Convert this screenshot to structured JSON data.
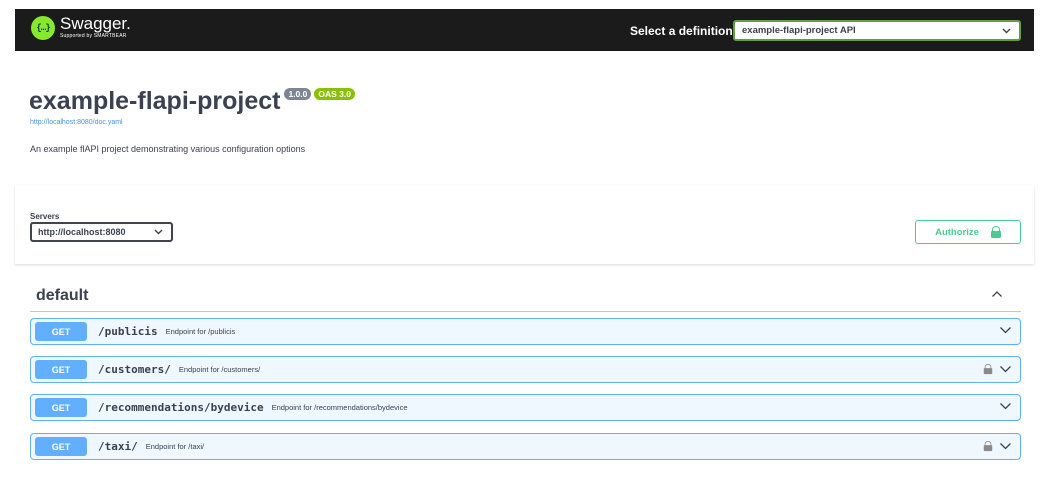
{
  "topbar": {
    "logo_mark": "{…}",
    "logo_name": "Swagger.",
    "logo_sub": "Supported by SMARTBEAR",
    "definition_label": "Select a definition",
    "definition_value": "example-flapi-project API"
  },
  "info": {
    "title": "example-flapi-project",
    "version": "1.0.0",
    "oas": "OAS 3.0",
    "doc_url": "http://localhost:8080/doc.yaml",
    "description": "An example flAPI project demonstrating various configuration options"
  },
  "servers": {
    "label": "Servers",
    "selected": "http://localhost:8080",
    "authorize_label": "Authorize"
  },
  "tag": {
    "name": "default",
    "expanded": true
  },
  "operations": [
    {
      "method": "GET",
      "path": "/publicis",
      "summary": "Endpoint for /publicis",
      "locked": false
    },
    {
      "method": "GET",
      "path": "/customers/",
      "summary": "Endpoint for /customers/",
      "locked": true
    },
    {
      "method": "GET",
      "path": "/recommendations/bydevice",
      "summary": "Endpoint for /recommendations/bydevice",
      "locked": false
    },
    {
      "method": "GET",
      "path": "/taxi/",
      "summary": "Endpoint for /taxi/",
      "locked": true
    }
  ],
  "colors": {
    "get_method": "#61affe",
    "authorize_green": "#49cc90",
    "topbar_bg": "#1b1b1b",
    "oas_badge": "#89bf04",
    "version_badge": "#7d8492"
  }
}
